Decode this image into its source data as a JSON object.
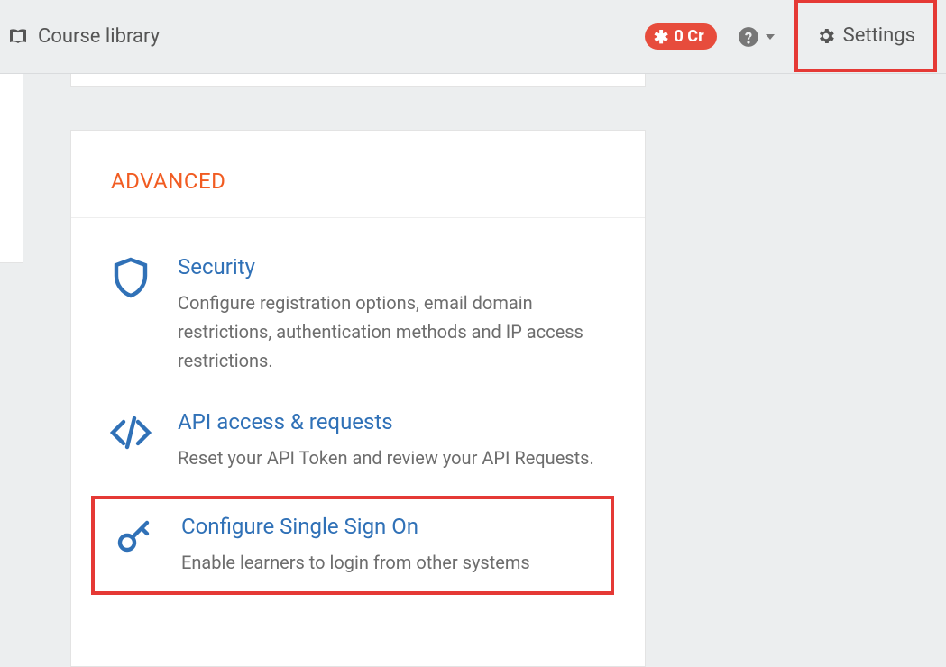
{
  "topbar": {
    "course_library": "Course library",
    "credits": "0 Cr",
    "settings": "Settings"
  },
  "card": {
    "section_title": "ADVANCED",
    "options": [
      {
        "title": "Security",
        "desc": "Configure registration options, email domain restrictions, authentication methods and IP access restrictions."
      },
      {
        "title": "API access & requests",
        "desc": "Reset your API Token and review your API Requests."
      },
      {
        "title": "Configure Single Sign On",
        "desc": "Enable learners to login from other systems"
      }
    ]
  }
}
